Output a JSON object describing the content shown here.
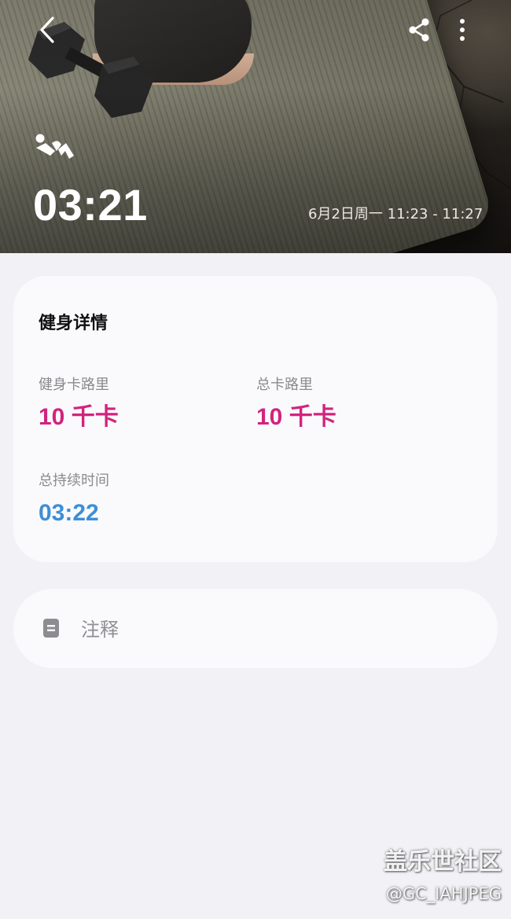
{
  "header": {
    "duration": "03:21",
    "time_range": "6月2日周一 11:23 - 11:27",
    "back_icon": "chevron-left-icon",
    "share_icon": "share-icon",
    "more_icon": "more-vertical-icon",
    "activity_icon": "workout-activity-icon"
  },
  "details": {
    "title": "健身详情",
    "metrics": [
      {
        "label": "健身卡路里",
        "value": "10 千卡",
        "color": "#d2237f"
      },
      {
        "label": "总卡路里",
        "value": "10 千卡",
        "color": "#d2237f"
      },
      {
        "label": "总持续时间",
        "value": "03:22",
        "color": "#3d8fd6"
      }
    ]
  },
  "notes": {
    "label": "注释",
    "icon": "note-icon"
  },
  "watermark": {
    "title": "盖乐世社区",
    "handle": "@GC_IAHJPEG"
  }
}
